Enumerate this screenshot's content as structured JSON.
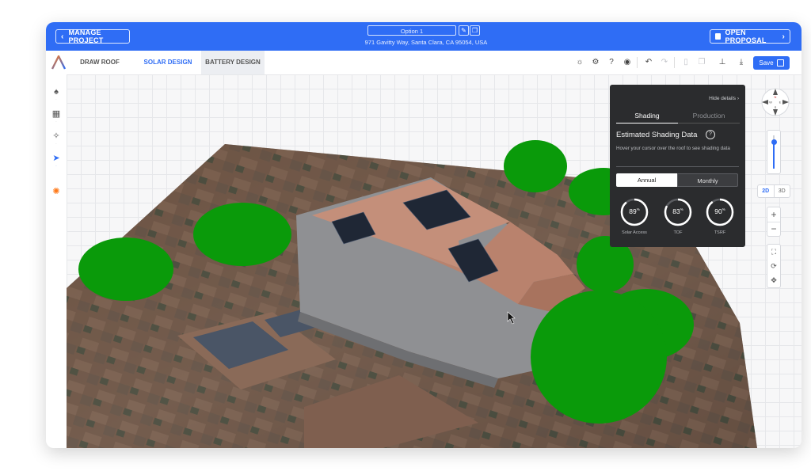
{
  "header": {
    "manage_project": "MANAGE PROJECT",
    "option_name": "Option 1",
    "address": "971 Gavitty Way, Santa Clara, CA 95054, USA",
    "open_proposal": "OPEN PROPOSAL"
  },
  "tabs": [
    {
      "label": "DRAW ROOF"
    },
    {
      "label": "SOLAR DESIGN",
      "active": true
    },
    {
      "label": "BATTERY DESIGN"
    }
  ],
  "toolbar": {
    "save_label": "Save"
  },
  "shading_panel": {
    "hide_details": "Hide details ›",
    "tabs": [
      "Shading",
      "Production"
    ],
    "title": "Estimated Shading Data",
    "description": "Hover your cursor over the roof to see shading data",
    "period_options": [
      "Annual",
      "Monthly"
    ],
    "metrics": [
      {
        "label": "Solar Access",
        "value": "89",
        "unit": "%",
        "fraction": 0.89
      },
      {
        "label": "TOF",
        "value": "83",
        "unit": "%",
        "fraction": 0.83
      },
      {
        "label": "TSRF",
        "value": "90",
        "unit": "%",
        "fraction": 0.9
      }
    ]
  },
  "view_controls": {
    "mode_2d": "2D",
    "mode_3d": "3D",
    "compass_letters": [
      "N",
      "W",
      "E",
      "S"
    ],
    "zoom_level_fraction": 0.8
  },
  "colors": {
    "brand": "#2f6df5",
    "tree": "#0a9a0a",
    "panel_bg": "#2b2c2e"
  }
}
